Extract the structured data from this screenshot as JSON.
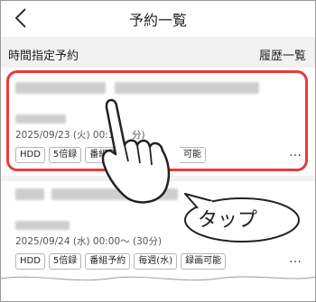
{
  "header": {
    "title": "予約一覧",
    "back_icon": "chevron-left-icon"
  },
  "subheader": {
    "left_label": "時間指定予約",
    "right_label": "履歴一覧"
  },
  "entries": [
    {
      "datetime": "2025/09/23 (火) 00:15",
      "datetime_tail": "分)",
      "tags": [
        "HDD",
        "5倍録",
        "番組予約"
      ],
      "tag_partial": "可能",
      "more": "…"
    },
    {
      "datetime": "2025/09/24 (水) 00:00～ (30分)",
      "tags": [
        "HDD",
        "5倍録",
        "番組予約",
        "毎週(水)",
        "録画可能"
      ],
      "more": "…"
    }
  ],
  "annotation": {
    "tap_label": "タップ"
  },
  "colors": {
    "highlight": "#e83a3a",
    "subheader_bg": "#f1f1f1"
  }
}
